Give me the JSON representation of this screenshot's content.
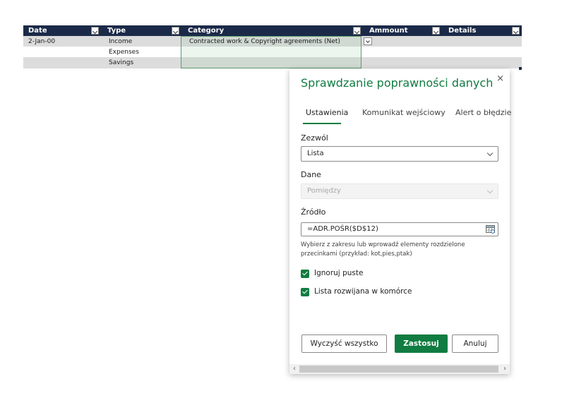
{
  "sheet": {
    "headers": [
      "Date",
      "Type",
      "Category",
      "Ammount",
      "Details"
    ],
    "rows": [
      {
        "date": "2-Jan-00",
        "type": "Income",
        "category": "Contracted work & Copyright agreements (Net)"
      },
      {
        "date": "",
        "type": "Expenses",
        "category": ""
      },
      {
        "date": "",
        "type": "Savings",
        "category": ""
      }
    ]
  },
  "dialog": {
    "title": "Sprawdzanie poprawności danych",
    "close": "×",
    "tabs": [
      "Ustawienia",
      "Komunikat wejściowy",
      "Alert o błędzie"
    ],
    "active_tab": "Ustawienia",
    "allow_label": "Zezwól",
    "allow_value": "Lista",
    "data_label": "Dane",
    "data_value": "Pomiędzy",
    "source_label": "Źródło",
    "source_value": "=ADR.POŚR($D$12)",
    "hint": "Wybierz z zakresu lub wprowadź elementy rozdzielone przecinkami (przykład: kot,pies,ptak)",
    "ignore_blank": "Ignoruj puste",
    "ignore_blank_checked": true,
    "in_cell_dropdown": "Lista rozwijana w komórce",
    "in_cell_dropdown_checked": true,
    "clear_all": "Wyczyść wszystko",
    "apply": "Zastosuj",
    "cancel": "Anuluj"
  },
  "colors": {
    "accent": "#107c41",
    "header_bg": "#1b2a48",
    "row_band": "#dcdcdc"
  }
}
